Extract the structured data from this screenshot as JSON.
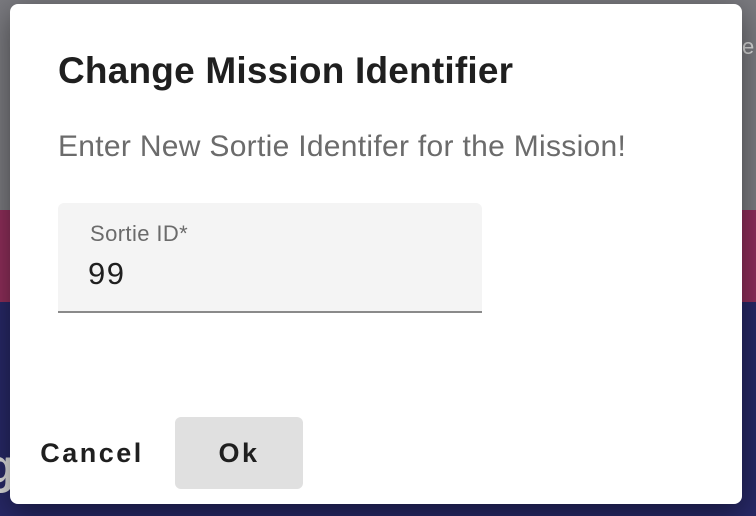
{
  "background": {
    "partial_text_right": "e",
    "partial_text_left": "g"
  },
  "dialog": {
    "title": "Change Mission Identifier",
    "message": "Enter New Sortie Identifer for the Mission!",
    "field": {
      "label": "Sortie ID*",
      "value": "99"
    },
    "buttons": {
      "cancel": "Cancel",
      "ok": "Ok"
    }
  },
  "colors": {
    "field_background": "#f4f4f4",
    "ok_button_background": "#e0e0e0",
    "backdrop_blue": "#272866"
  }
}
